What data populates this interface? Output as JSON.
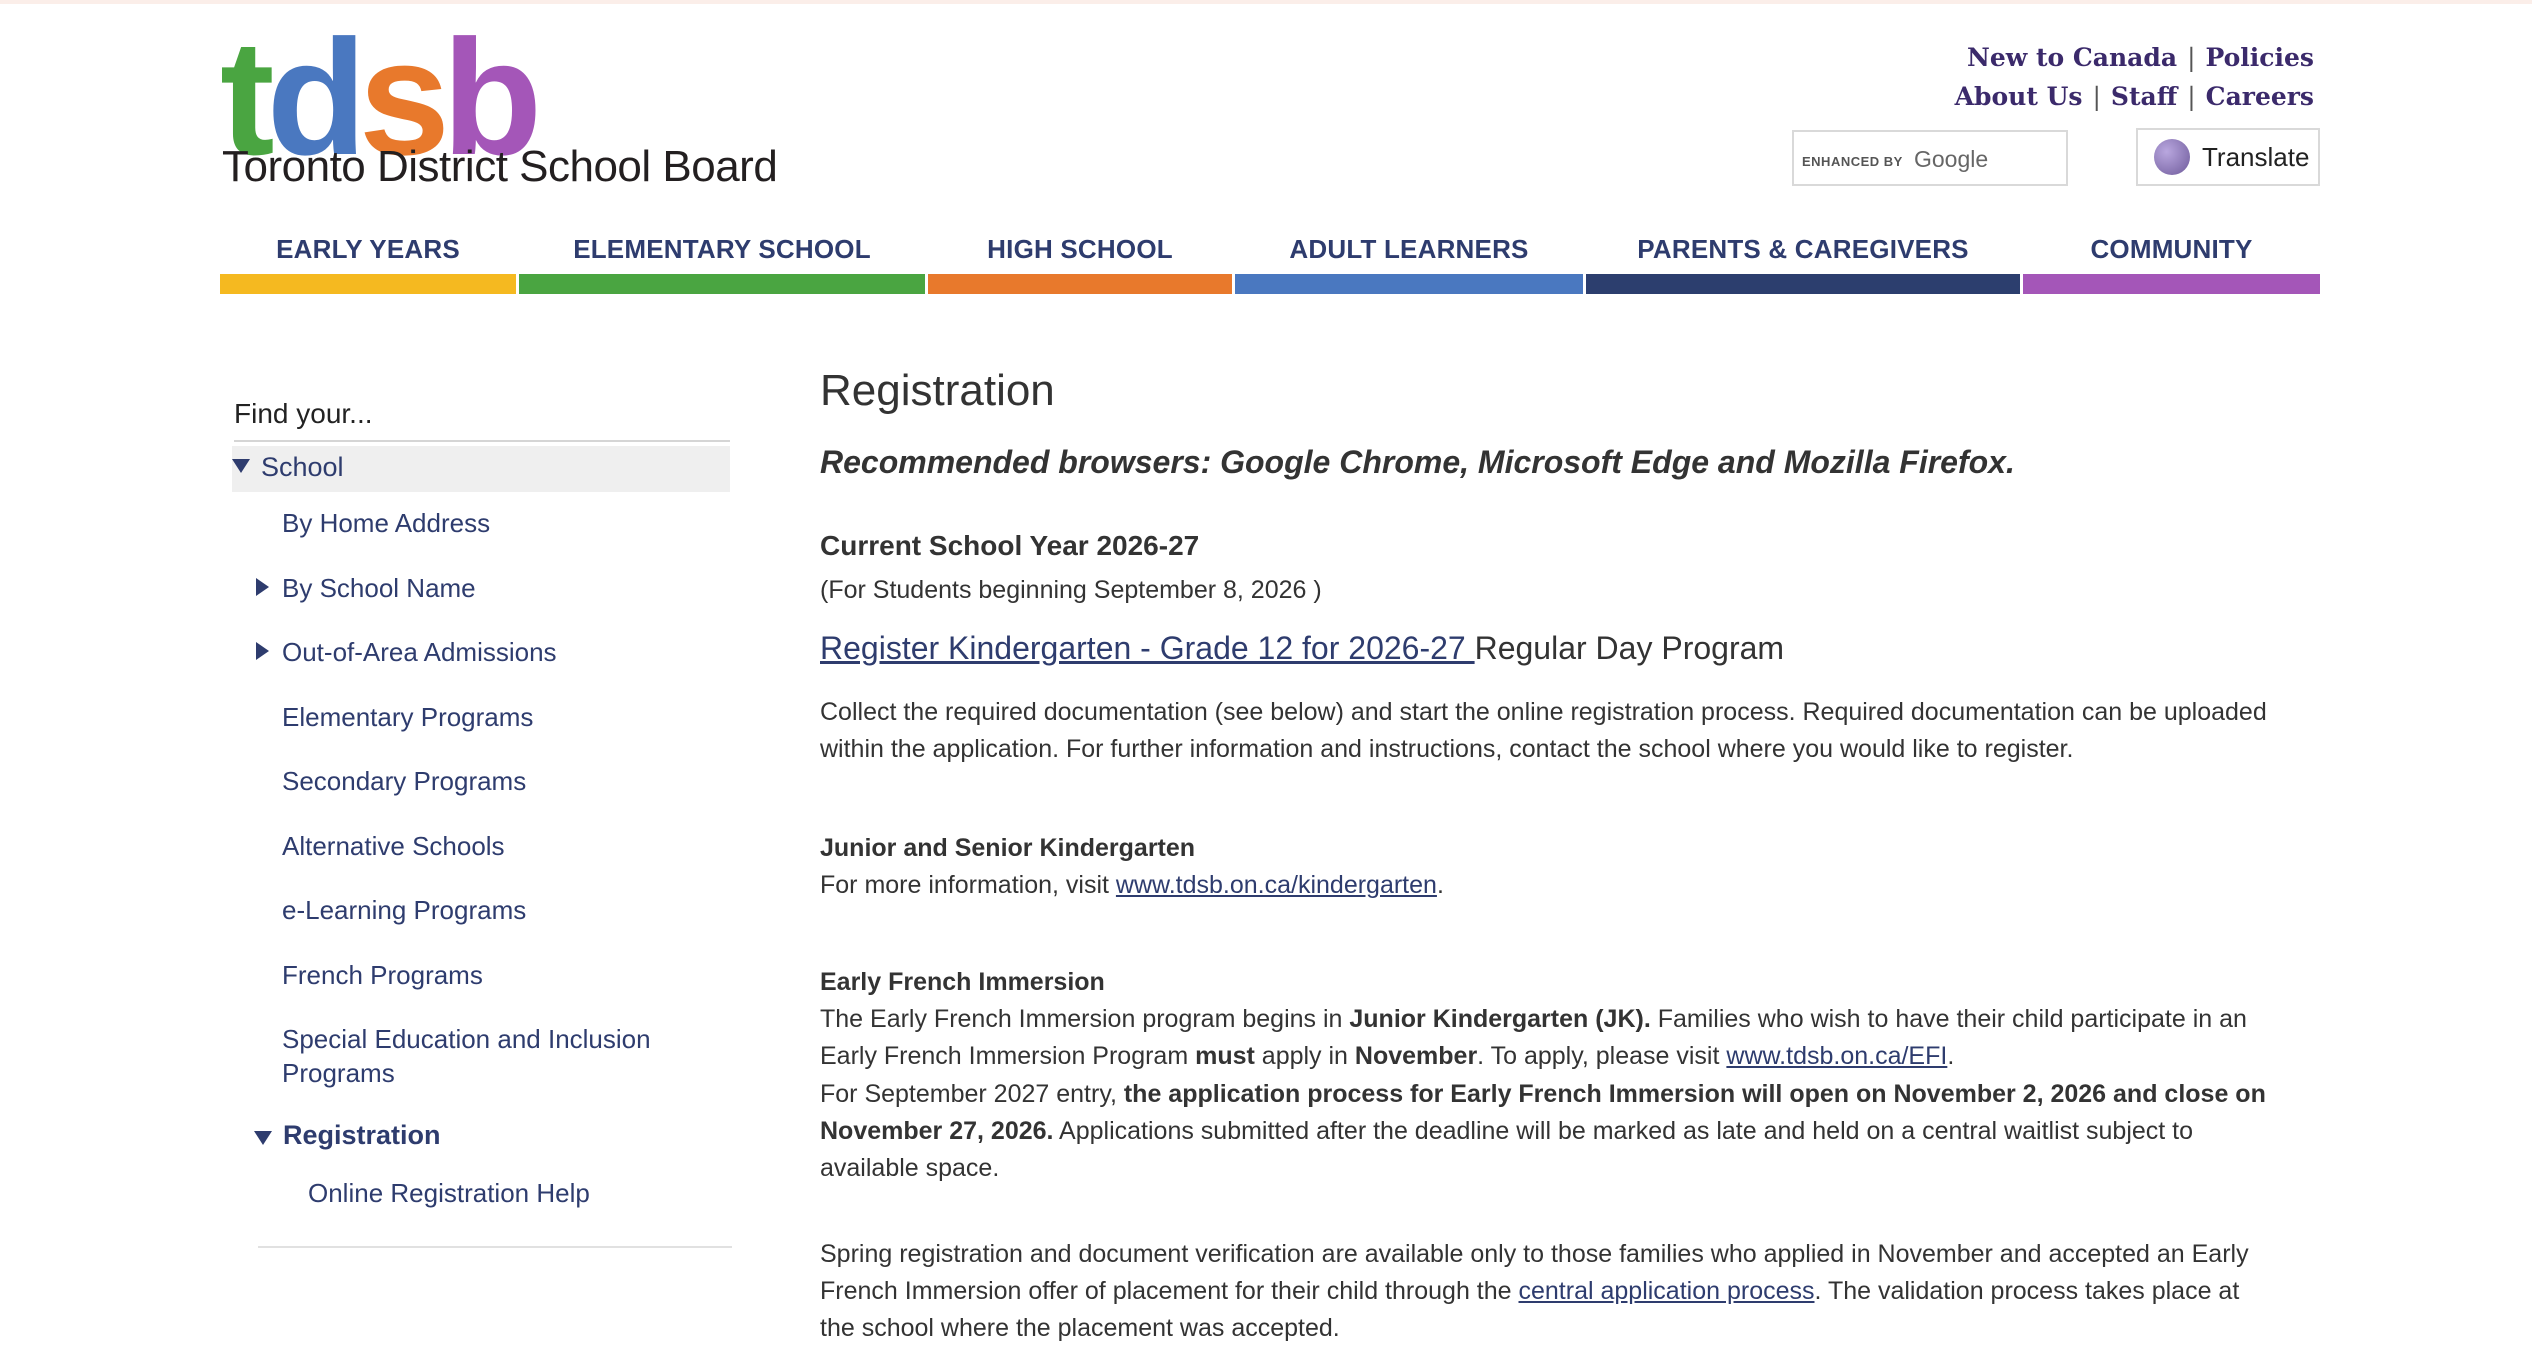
{
  "logo": {
    "letters": [
      {
        "ch": "t",
        "color": "#4aa541"
      },
      {
        "ch": "d",
        "color": "#4a78c0"
      },
      {
        "ch": "s",
        "color": "#e8792c"
      },
      {
        "ch": "b",
        "color": "#a456b8"
      }
    ],
    "tagline": "Toronto District School Board"
  },
  "utility": {
    "new_to_canada": "New to Canada",
    "policies": "Policies",
    "about_us": "About Us",
    "staff": "Staff",
    "careers": "Careers",
    "separator": "|"
  },
  "search": {
    "enhanced_by": "ENHANCED BY",
    "google": "Google"
  },
  "translate": {
    "label": "Translate",
    "icon": "globe-icon"
  },
  "nav": [
    {
      "label": "EARLY YEARS",
      "color": "#f5b920"
    },
    {
      "label": "ELEMENTARY SCHOOL",
      "color": "#4aa541"
    },
    {
      "label": "HIGH SCHOOL",
      "color": "#e8792c"
    },
    {
      "label": "ADULT LEARNERS",
      "color": "#4a78c0"
    },
    {
      "label": "PARENTS & CAREGIVERS",
      "color": "#2c3e6e"
    },
    {
      "label": "COMMUNITY",
      "color": "#a456b8"
    }
  ],
  "sidebar": {
    "find_your": "Find your...",
    "school": "School",
    "items": [
      {
        "label": "By Home Address",
        "arrow": false
      },
      {
        "label": "By School Name",
        "arrow": true
      },
      {
        "label": "Out-of-Area Admissions",
        "arrow": true
      },
      {
        "label": "Elementary Programs",
        "arrow": false
      },
      {
        "label": "Secondary Programs",
        "arrow": false
      },
      {
        "label": "Alternative Schools",
        "arrow": false
      },
      {
        "label": "e-Learning Programs",
        "arrow": false
      },
      {
        "label": "French Programs",
        "arrow": false
      },
      {
        "label": "Special Education and Inclusion Programs",
        "arrow": false
      }
    ],
    "registration": "Registration",
    "online_help": "Online Registration Help"
  },
  "content": {
    "title": "Registration",
    "recommended": "Recommended browsers: Google Chrome, Microsoft Edge and Mozilla Firefox.",
    "current_year": "Current School Year 2026-27",
    "current_year_sub": "(For Students beginning September 8, 2026 )",
    "register_link": "Register Kindergarten - Grade 12 for 2026-27 ",
    "register_suffix": "Regular Day Program",
    "collect_para": "Collect the required documentation (see below) and start the online registration process. Required documentation can be uploaded within the application. For further information and instructions, contact the school where you would like to register.",
    "jk_heading": "Junior and Senior Kindergarten",
    "jk_text": "For more information, visit ",
    "jk_link": "www.tdsb.on.ca/kindergarten",
    "jk_end": ".",
    "efi_heading": "Early French Immersion",
    "efi_p1_a": "The Early French Immersion program begins in ",
    "efi_p1_b": "Junior Kindergarten (JK).",
    "efi_p1_c": "  Families who wish to have their child participate in an Early French Immersion Program  ",
    "efi_p1_d": "must",
    "efi_p1_e": " apply in  ",
    "efi_p1_f": "November",
    "efi_p1_g": ". To apply, please visit ",
    "efi_p1_link": "www.tdsb.on.ca/EFI",
    "efi_p1_end": ".",
    "efi_p2_a": "For September 2027 entry, ",
    "efi_p2_b": "the application process for Early French Immersion will open on November 2, 2026 and close on November 27, 2026.",
    "efi_p2_c": "  Applications submitted after the deadline will be marked as late and held on a central waitlist subject to available space.",
    "efi_p3_a": "Spring registration and document verification are available only to those families who applied in November and accepted an Early French Immersion offer of placement for their child through the ",
    "efi_p3_link": "central application process",
    "efi_p3_b": ". The validation process takes place at the school where the placement was accepted."
  }
}
